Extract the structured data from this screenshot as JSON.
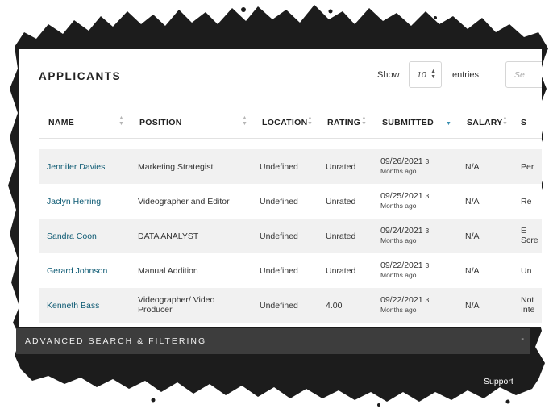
{
  "page": {
    "title": "APPLICANTS",
    "show_label": "Show",
    "page_size": "10",
    "entries_label": "entries",
    "search_placeholder": "Se"
  },
  "columns": [
    {
      "label": "NAME"
    },
    {
      "label": "POSITION"
    },
    {
      "label": "LOCATION"
    },
    {
      "label": "RATING"
    },
    {
      "label": "SUBMITTED"
    },
    {
      "label": "SALARY"
    },
    {
      "label": "S"
    }
  ],
  "rows": [
    {
      "name": "Jennifer Davies",
      "position": "Marketing Strategist",
      "position2": "",
      "location": "Undefined",
      "rating": "Unrated",
      "submitted": "09/26/2021",
      "ago_a": "3",
      "ago_b": "Months ago",
      "salary": "N/A",
      "status": "Per",
      "status2": ""
    },
    {
      "name": "Jaclyn Herring",
      "position": "Videographer and Editor",
      "position2": "",
      "location": "Undefined",
      "rating": "Unrated",
      "submitted": "09/25/2021",
      "ago_a": "3",
      "ago_b": "Months ago",
      "salary": "N/A",
      "status": "Re",
      "status2": ""
    },
    {
      "name": "Sandra Coon",
      "position": "DATA ANALYST",
      "position2": "",
      "location": "Undefined",
      "rating": "Unrated",
      "submitted": "09/24/2021",
      "ago_a": "3",
      "ago_b": "Months ago",
      "salary": "N/A",
      "status": "E",
      "status2": "Scre"
    },
    {
      "name": "Gerard Johnson",
      "position": "Manual Addition",
      "position2": "",
      "location": "Undefined",
      "rating": "Unrated",
      "submitted": "09/22/2021",
      "ago_a": "3",
      "ago_b": "Months ago",
      "salary": "N/A",
      "status": "Un",
      "status2": ""
    },
    {
      "name": "Kenneth Bass",
      "position": "Videographer/ Video",
      "position2": "Producer",
      "location": "Undefined",
      "rating": "4.00",
      "submitted": "09/22/2021",
      "ago_a": "3",
      "ago_b": "Months ago",
      "salary": "N/A",
      "status": "Not",
      "status2": "Inte"
    }
  ],
  "advanced": {
    "label": "ADVANCED SEARCH & FILTERING",
    "toggle": "-"
  },
  "footer": {
    "support": "Support"
  },
  "colors": {
    "backdrop": "#1a1a1a",
    "link": "#0d5a73",
    "bar": "#3d3d3d",
    "sort_active": "#3a8fb0"
  },
  "icons": [
    "sort-icon",
    "select-arrows-icon"
  ]
}
